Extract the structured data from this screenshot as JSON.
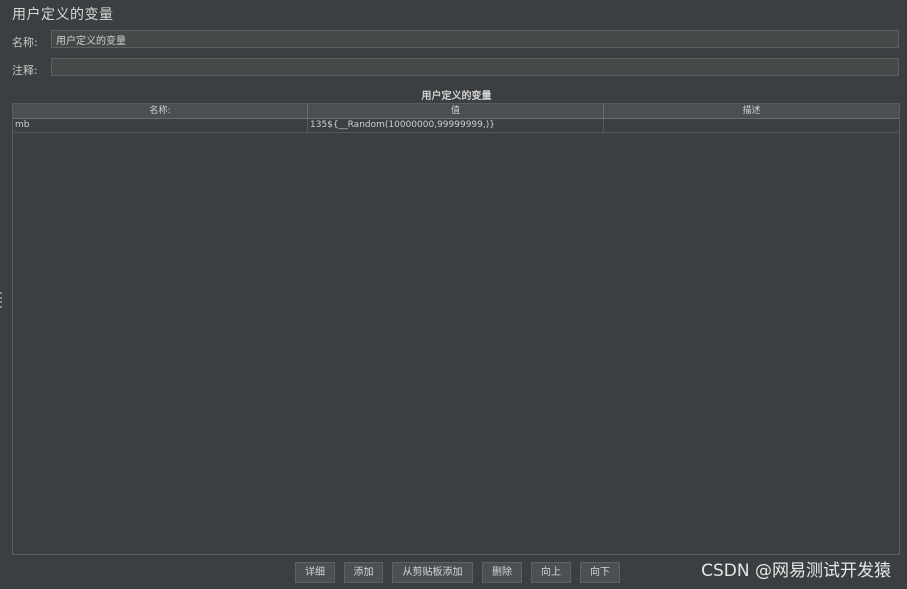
{
  "panel": {
    "title": "用户定义的变量"
  },
  "form": {
    "name_label": "名称:",
    "name_value": "用户定义的变量",
    "comment_label": "注释:",
    "comment_value": ""
  },
  "table": {
    "title": "用户定义的变量",
    "headers": [
      "名称:",
      "值",
      "描述"
    ],
    "rows": [
      {
        "name": "mb",
        "value": "135${__Random(10000000,99999999,)}",
        "description": ""
      }
    ]
  },
  "buttons": {
    "detail": "详细",
    "add": "添加",
    "paste": "从剪贴板添加",
    "delete": "删除",
    "up": "向上",
    "down": "向下"
  },
  "watermark": "CSDN @网易测试开发猿"
}
